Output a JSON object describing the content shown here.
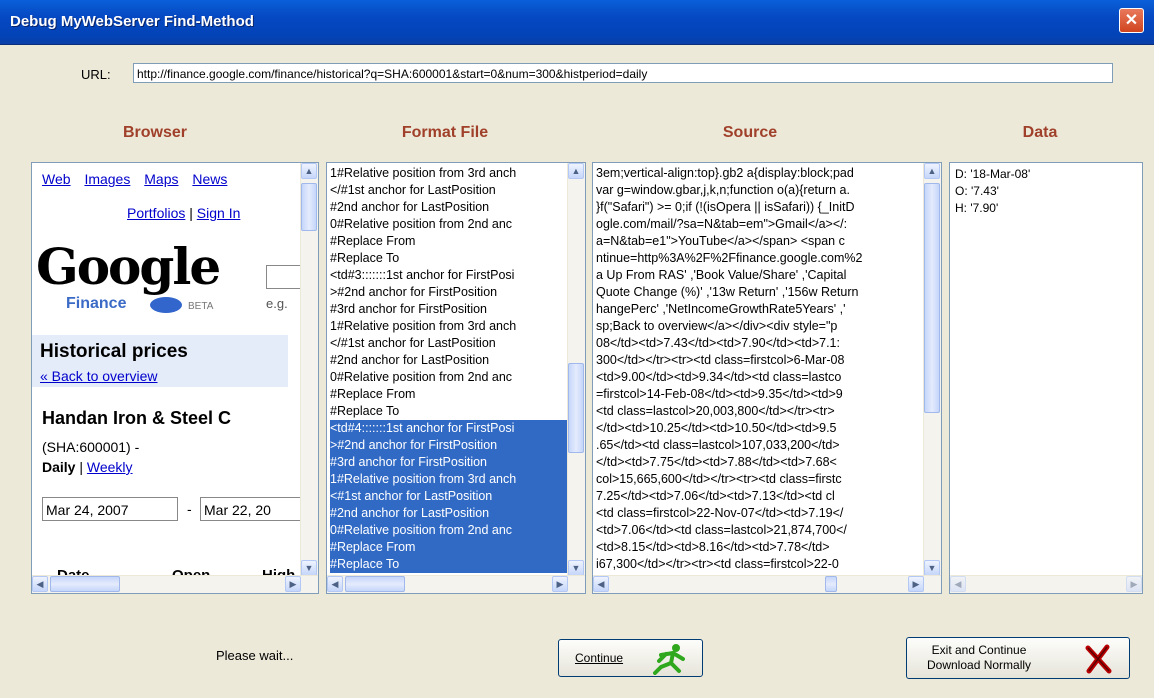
{
  "window": {
    "title": "Debug MyWebServer Find-Method",
    "close_glyph": "✕"
  },
  "url": {
    "label": "URL:",
    "value": "http://finance.google.com/finance/historical?q=SHA:600001&start=0&num=300&histperiod=daily"
  },
  "columns": {
    "browser": "Browser",
    "format": "Format File",
    "source": "Source",
    "data": "Data"
  },
  "browser": {
    "nav": [
      "Web",
      "Images",
      "Maps",
      "News"
    ],
    "portfolios": "Portfolios",
    "sep": "|",
    "sign_in": "Sign In",
    "logo": "Google",
    "logo_sub": "Finance",
    "beta": "BETA",
    "eg": "e.g.",
    "heading": "Historical prices",
    "back": "« Back to overview",
    "company": "Handan Iron & Steel C",
    "ticker": "(SHA:600001) -",
    "daily": "Daily",
    "weekly": "Weekly",
    "date_from": "Mar 24, 2007",
    "dash": "-",
    "date_to": "Mar 22, 20",
    "table_headers": [
      "Date",
      "Open",
      "High"
    ]
  },
  "format_lines": [
    "1#Relative position from 3rd anch",
    "</#1st anchor for LastPosition",
    "#2nd anchor for LastPosition",
    "0#Relative position from 2nd anc",
    "#Replace From",
    "#Replace To",
    "<td#3:::::::1st anchor for FirstPosi",
    ">#2nd anchor for FirstPosition",
    "#3rd anchor for FirstPosition",
    "1#Relative position from 3rd anch",
    "</#1st anchor for LastPosition",
    "#2nd anchor for LastPosition",
    "0#Relative position from 2nd anc",
    "#Replace From",
    "#Replace To",
    "<td#4:::::::1st anchor for FirstPosi",
    ">#2nd anchor for FirstPosition",
    "#3rd anchor for FirstPosition",
    "1#Relative position from 3rd anch",
    "<#1st anchor for LastPosition",
    "#2nd anchor for LastPosition",
    "0#Relative position from 2nd anc",
    "#Replace From",
    "#Replace To"
  ],
  "source_lines": [
    "3em;vertical-align:top}.gb2 a{display:block;pad",
    "var g=window.gbar,j,k,n;function o(a){return a.",
    "}f(\"Safari\") >= 0;if (!(isOpera || isSafari)) {_InitD",
    "ogle.com/mail/?sa=N&tab=em\">Gmail</a></:",
    "a=N&tab=e1\">YouTube</a></span> <span c",
    "ntinue=http%3A%2F%2Ffinance.google.com%2",
    "a Up From RAS' ,'Book Value/Share' ,'Capital",
    "Quote Change (%)' ,'13w Return' ,'156w Return",
    "hangePerc' ,'NetIncomeGrowthRate5Years' ,'",
    "sp;Back to overview</a></div><div style=\"p",
    "08</td><td>7.43</td><td>7.90</td><td>7.1:",
    "300</td></tr><tr><td class=firstcol>6-Mar-08",
    "<td>9.00</td><td>9.34</td><td class=lastco",
    "=firstcol>14-Feb-08</td><td>9.35</td><td>9",
    "<td class=lastcol>20,003,800</td></tr><tr>",
    "</td><td>10.25</td><td>10.50</td><td>9.5",
    ".65</td><td class=lastcol>107,033,200</td>",
    "</td><td>7.75</td><td>7.88</td><td>7.68<",
    "col>15,665,600</td></tr><tr><td class=firstc",
    "7.25</td><td>7.06</td><td>7.13</td><td cl",
    "<td class=firstcol>22-Nov-07</td><td>7.19</",
    "<td>7.06</td><td class=lastcol>21,874,700</",
    "<td>8.15</td><td>8.16</td><td>7.78</td>",
    "i67,300</td></tr><tr><td class=firstcol>22-0"
  ],
  "data_lines": [
    "D:  '18-Mar-08'",
    "O:  '7.43'",
    "H:  '7.90'"
  ],
  "status": "Please wait...",
  "buttons": {
    "continue": "Continue",
    "exit_line1": "Exit and Continue",
    "exit_line2": "Download Normally"
  }
}
